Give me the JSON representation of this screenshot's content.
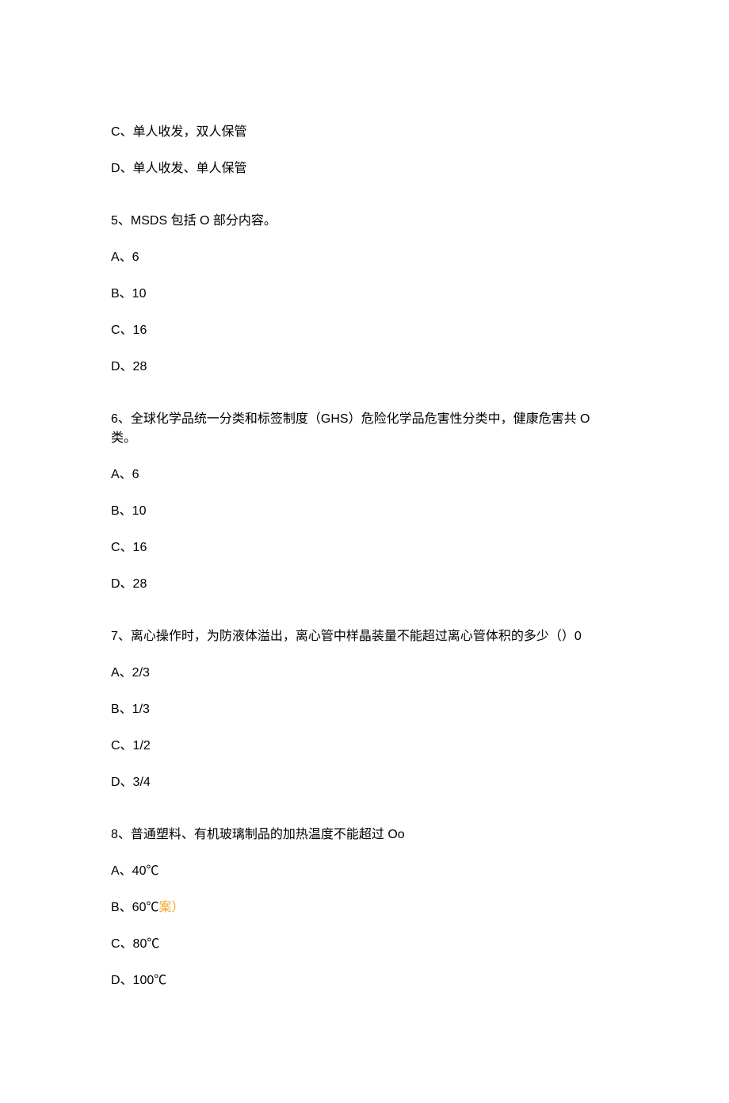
{
  "partial_question": {
    "optionC": "C、单人收发，双人保管",
    "optionD": "D、单人收发、单人保管"
  },
  "questions": [
    {
      "stem": "5、MSDS 包括 O 部分内容。",
      "options": [
        "A、6",
        "B、10",
        "C、16",
        "D、28"
      ]
    },
    {
      "stem": "6、全球化学品统一分类和标签制度（GHS）危险化学品危害性分类中，健康危害共 O 类。",
      "options": [
        "A、6",
        "B、10",
        "C、16",
        "D、28"
      ]
    },
    {
      "stem": "7、离心操作时，为防液体溢出，离心管中样晶装量不能超过离心管体积的多少（）0",
      "options": [
        "A、2/3",
        "B、1/3",
        "C、1/2",
        "D、3/4"
      ]
    },
    {
      "stem": "8、普通塑料、有机玻璃制品的加热温度不能超过 Oo",
      "options": [
        "A、40℃",
        "B、60℃",
        "C、80℃",
        "D、100℃"
      ]
    }
  ],
  "answer_suffix": "案）"
}
